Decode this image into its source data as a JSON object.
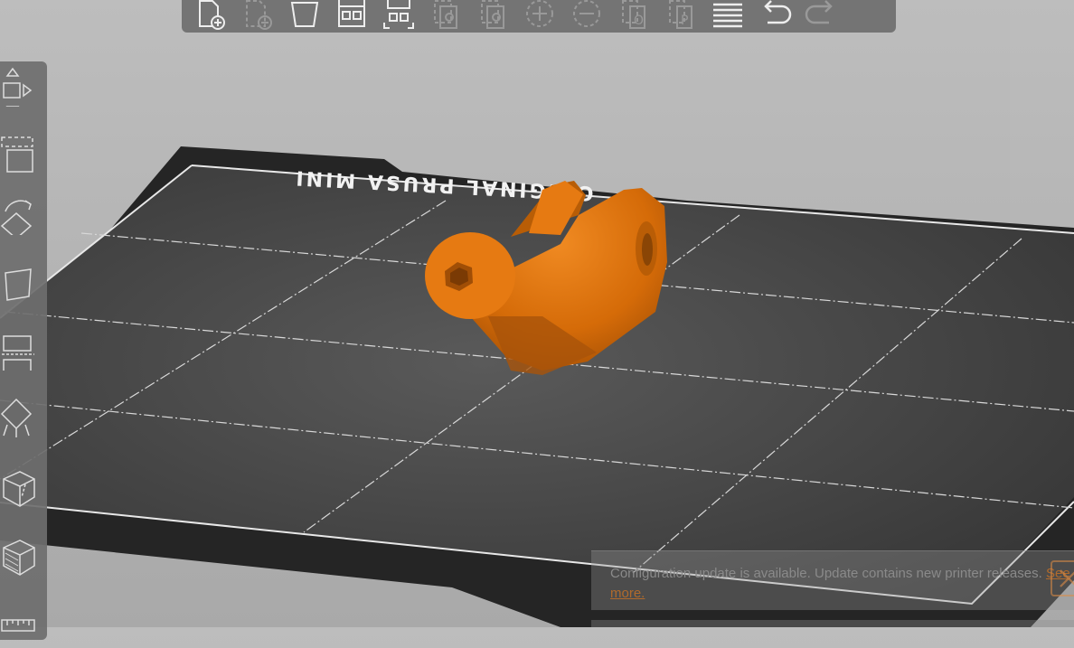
{
  "app": {
    "bed_label": "ORIGINAL PRUSA MINI",
    "model_color": "#e67a12",
    "bed_color": "#3c3c3c"
  },
  "top_toolbar": {
    "buttons": [
      {
        "name": "add",
        "icon": "add-object-icon",
        "enabled": true
      },
      {
        "name": "delete",
        "icon": "delete-icon",
        "enabled": false
      },
      {
        "name": "delete-all",
        "icon": "delete-all-icon",
        "enabled": true
      },
      {
        "name": "arrange",
        "icon": "arrange-icon",
        "enabled": true
      },
      {
        "name": "arrange-selection",
        "icon": "arrange-selection-icon",
        "enabled": true
      },
      {
        "name": "copy",
        "icon": "copy-icon",
        "enabled": false
      },
      {
        "name": "paste",
        "icon": "paste-icon",
        "enabled": false
      },
      {
        "name": "add-instance",
        "icon": "add-instance-icon",
        "enabled": false
      },
      {
        "name": "remove-instance",
        "icon": "remove-instance-icon",
        "enabled": false
      },
      {
        "name": "split-objects",
        "icon": "split-objects-icon",
        "enabled": false
      },
      {
        "name": "split-parts",
        "icon": "split-parts-icon",
        "enabled": false
      },
      {
        "name": "layers-editing",
        "icon": "layers-editing-icon",
        "enabled": true
      },
      {
        "name": "undo",
        "icon": "undo-icon",
        "enabled": true
      },
      {
        "name": "redo",
        "icon": "redo-icon",
        "enabled": false
      }
    ]
  },
  "left_toolbar": {
    "tools": [
      {
        "name": "move",
        "icon": "move-icon"
      },
      {
        "name": "scale",
        "icon": "scale-icon"
      },
      {
        "name": "rotate",
        "icon": "rotate-icon"
      },
      {
        "name": "place-on-face",
        "icon": "place-on-face-icon"
      },
      {
        "name": "cut",
        "icon": "cut-icon"
      },
      {
        "name": "support-painting",
        "icon": "support-painting-icon"
      },
      {
        "name": "seam-painting",
        "icon": "seam-painting-icon"
      },
      {
        "name": "variable-layer",
        "icon": "fdm-supports-icon"
      },
      {
        "name": "measure",
        "icon": "measure-icon"
      }
    ]
  },
  "notification": {
    "text": "Configuration update is available. Update contains new printer releases.",
    "link": "See more."
  }
}
